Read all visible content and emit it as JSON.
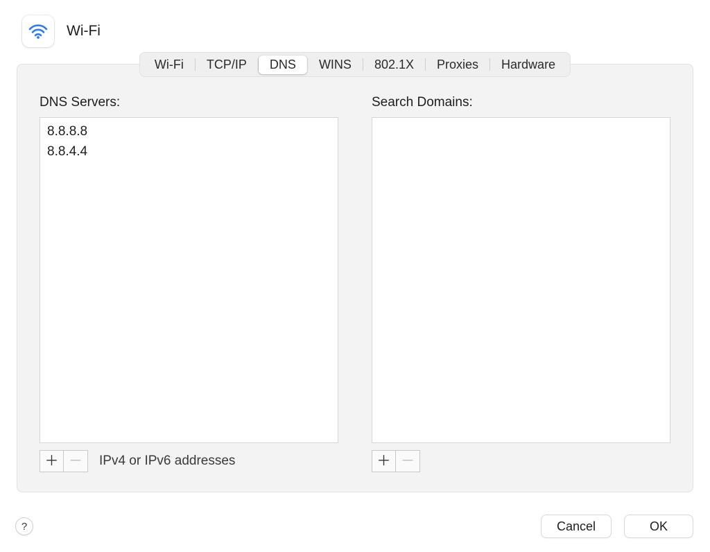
{
  "header": {
    "title": "Wi-Fi"
  },
  "tabs": {
    "items": [
      {
        "label": "Wi-Fi",
        "active": false
      },
      {
        "label": "TCP/IP",
        "active": false
      },
      {
        "label": "DNS",
        "active": true
      },
      {
        "label": "WINS",
        "active": false
      },
      {
        "label": "802.1X",
        "active": false
      },
      {
        "label": "Proxies",
        "active": false
      },
      {
        "label": "Hardware",
        "active": false
      }
    ]
  },
  "dns": {
    "servers_label": "DNS Servers:",
    "servers": [
      "8.8.8.8",
      "8.8.4.4"
    ],
    "hint": "IPv4 or IPv6 addresses",
    "domains_label": "Search Domains:",
    "domains": []
  },
  "buttons": {
    "help": "?",
    "cancel": "Cancel",
    "ok": "OK",
    "plus": "＋",
    "minus": "－"
  }
}
